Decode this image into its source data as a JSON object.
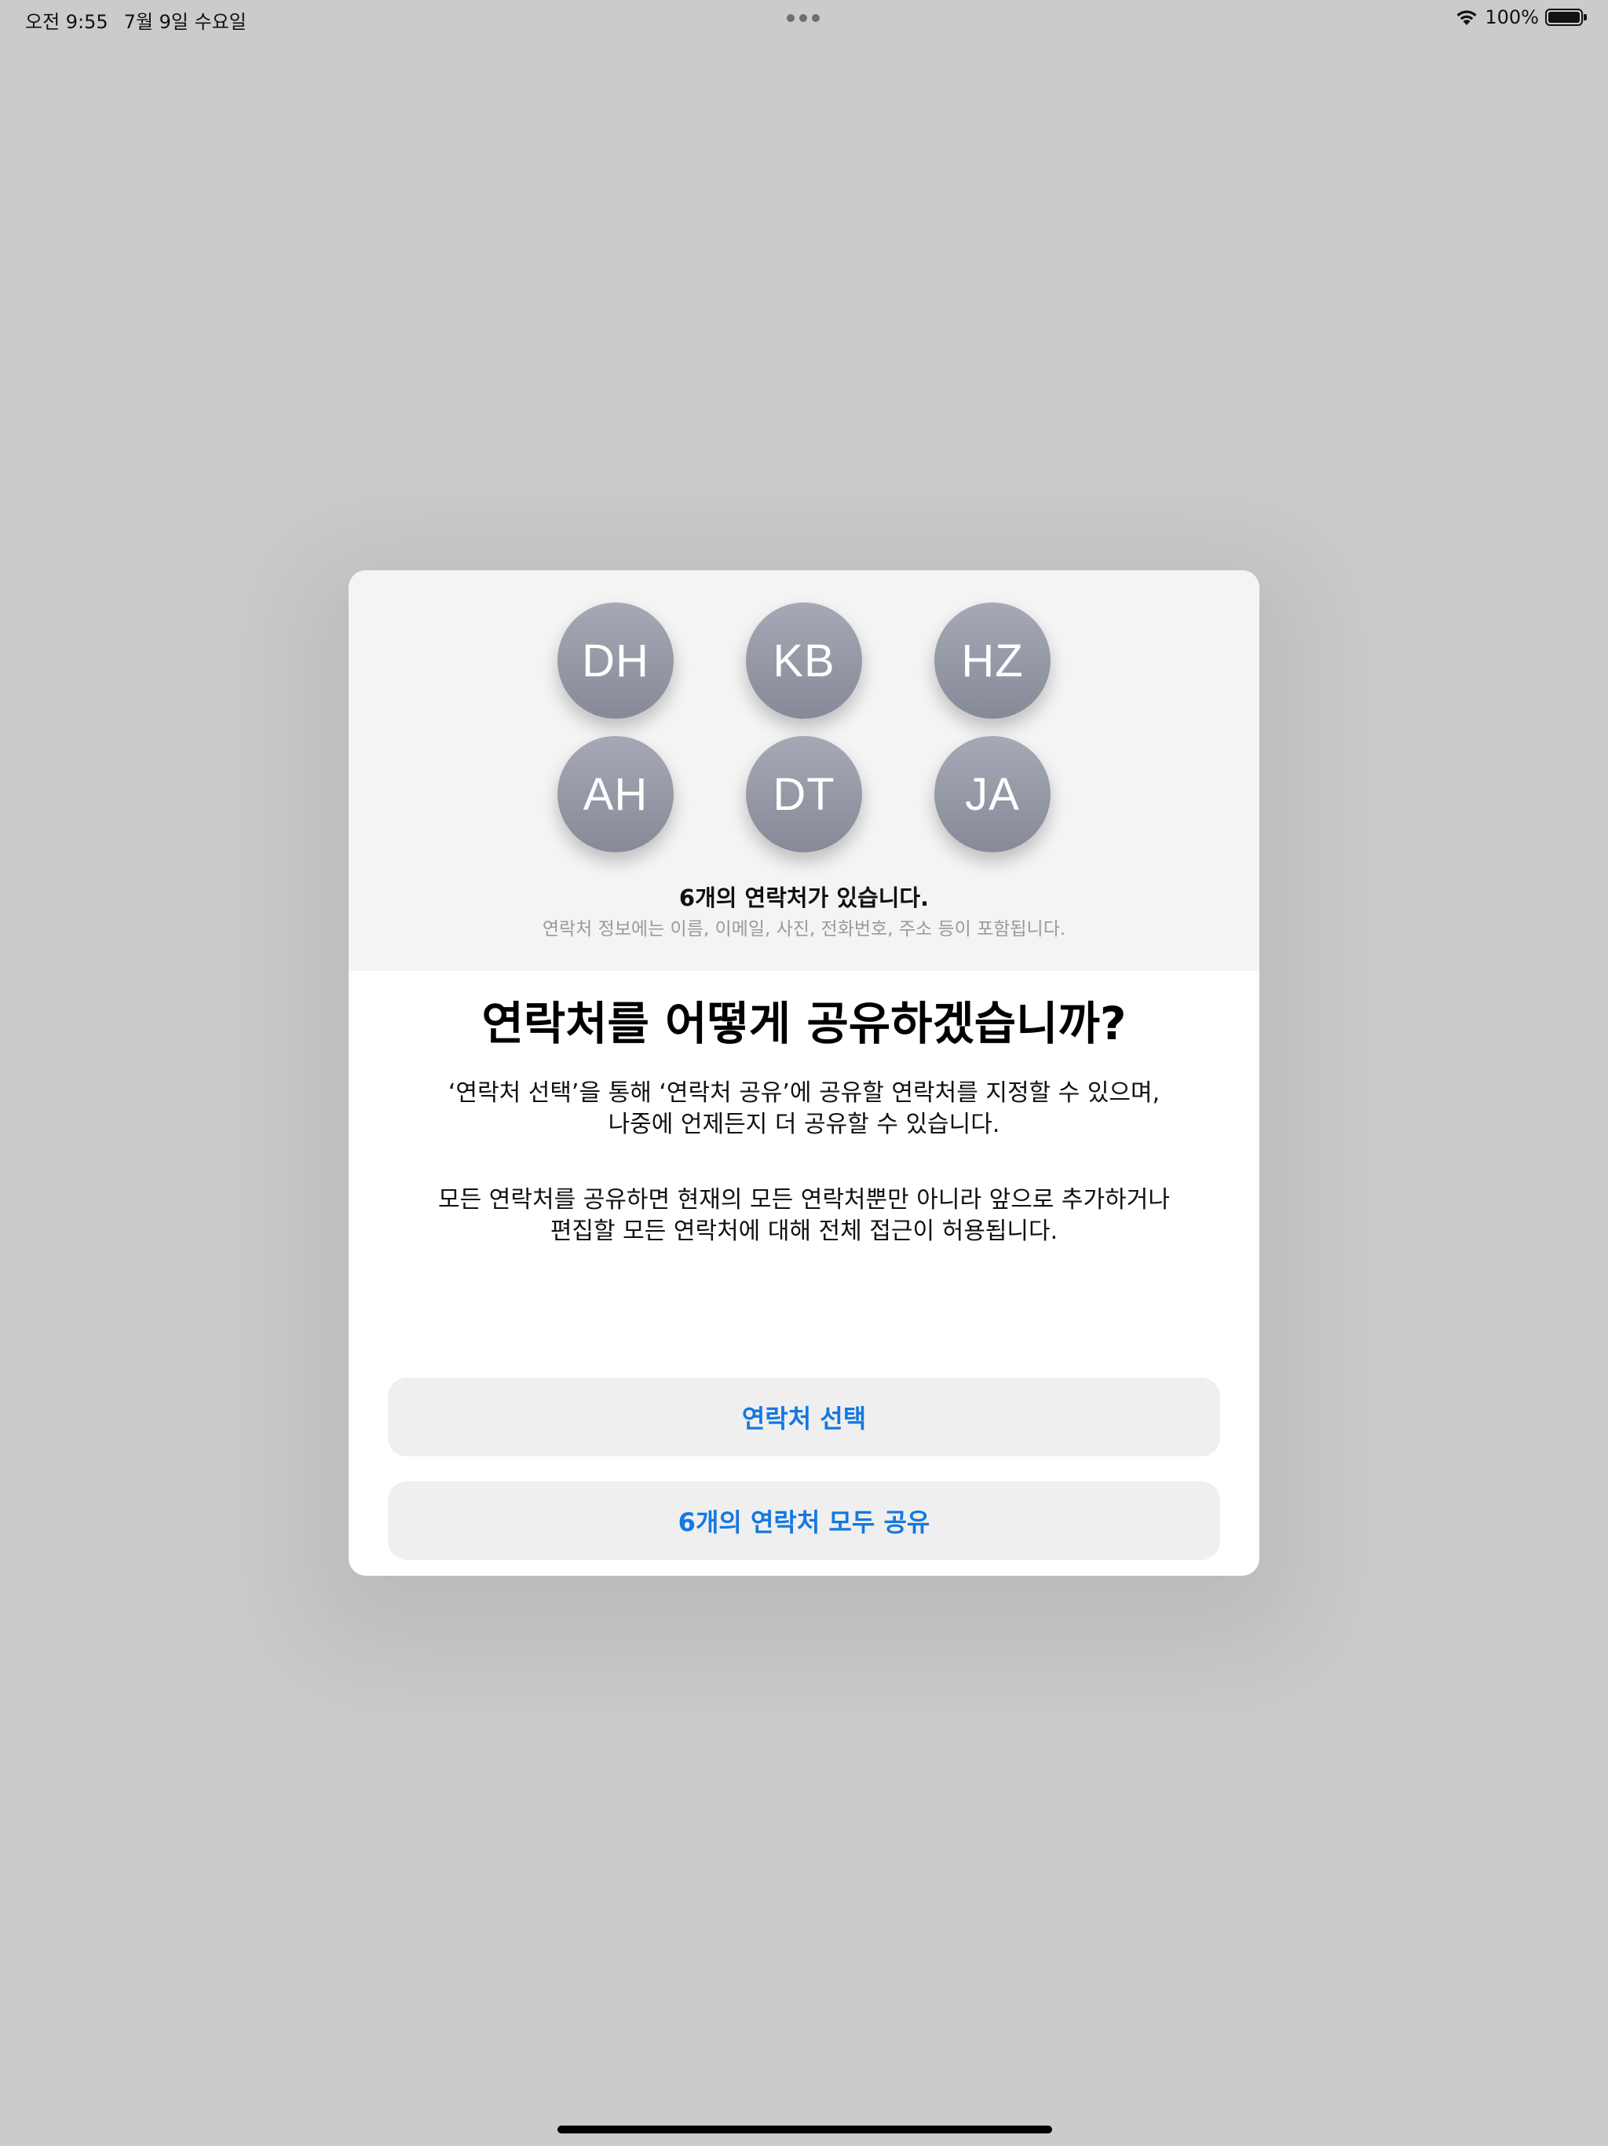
{
  "status_bar": {
    "time": "오전 9:55",
    "date": "7월 9일 수요일",
    "battery": "100%",
    "battery_level": 1.0
  },
  "sheet": {
    "avatars": [
      "DH",
      "KB",
      "HZ",
      "AH",
      "DT",
      "JA"
    ],
    "contact_count": "6개의 연락처가 있습니다.",
    "contact_info": "연락처 정보에는 이름, 이메일, 사진, 전화번호, 주소 등이 포함됩니다.",
    "title": "연락처를 어떻게 공유하겠습니까?",
    "body_1_line_1": "‘연락처 선택’을 통해 ‘연락처 공유’에 공유할 연락처를 지정할 수 있으며,",
    "body_1_line_2": "나중에 언제든지 더 공유할 수 있습니다.",
    "body_2_line_1": "모든 연락처를 공유하면 현재의 모든 연락처뿐만 아니라 앞으로 추가하거나",
    "body_2_line_2": "편집할 모든 연락처에 대해 전체 접근이 허용됩니다.",
    "select_button": "연락처 선택",
    "share_all_button": "6개의 연락처 모두 공유"
  },
  "colors": {
    "accent": "#1478e0",
    "backdrop": "#cbcbcb",
    "avatar": "#8f93a0"
  }
}
